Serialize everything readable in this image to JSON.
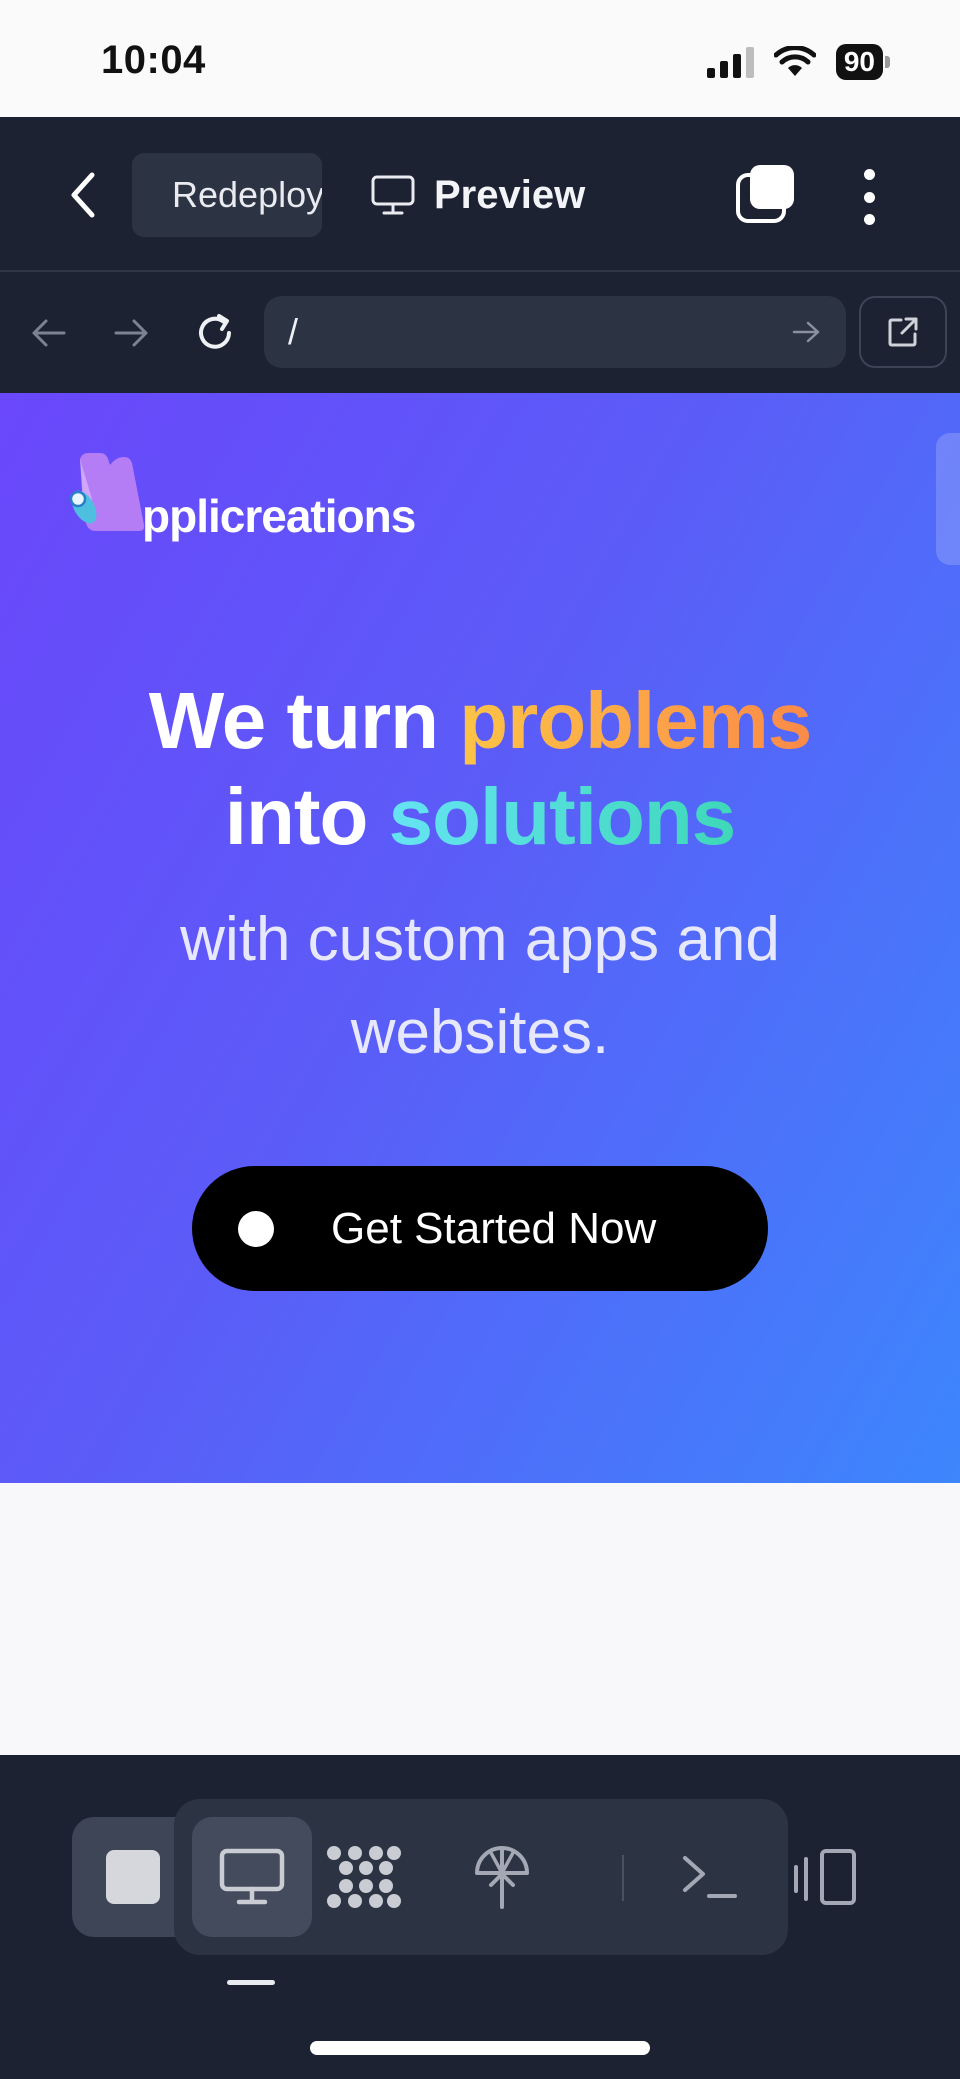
{
  "status_bar": {
    "time": "10:04",
    "battery": "90"
  },
  "header": {
    "tabs": [
      {
        "label": "Redeploy",
        "icon": "deploy-icon"
      },
      {
        "label": "Preview",
        "icon": "monitor-icon"
      }
    ]
  },
  "url_bar": {
    "path": "/"
  },
  "preview": {
    "logo_text": "pplicreations",
    "headline": {
      "w1": "We turn",
      "w2": "problems",
      "w3": "into",
      "w4": "solutions"
    },
    "subline": "with custom apps and websites.",
    "cta_label": "Get Started Now"
  },
  "colors": {
    "app_dark": "#1c2231",
    "hero_start": "#6a47fb",
    "hero_end": "#3d86fc",
    "accent_orange": "#fcc347",
    "accent_teal": "#4fdccf",
    "deploy_green": "#6ee7a0"
  },
  "bottom_toolbar": {
    "items": [
      "stop-icon",
      "monitor-icon",
      "workflow-icon",
      "deploy-icon",
      "terminal-icon",
      "devices-icon"
    ]
  }
}
